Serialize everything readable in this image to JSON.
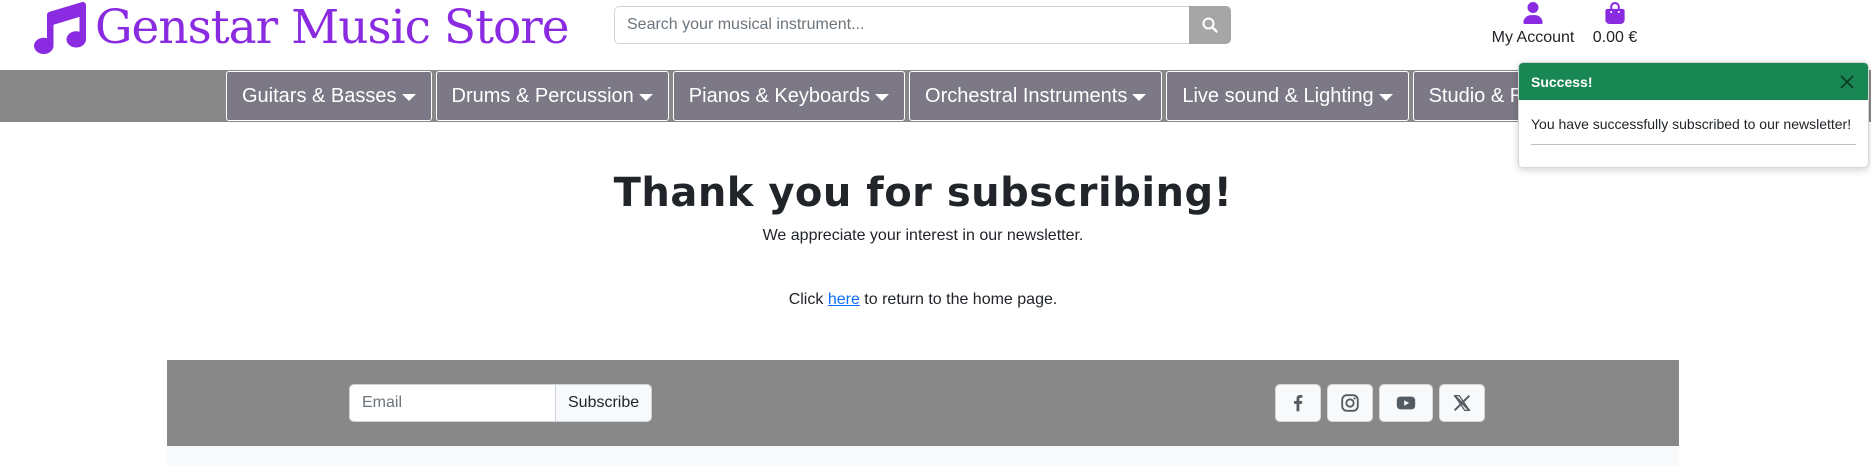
{
  "header": {
    "logo_text": "Genstar Music Store",
    "logo_icon": "music-note-icon",
    "search_placeholder": "Search your musical instrument...",
    "search_icon": "search-icon",
    "account_label": "My Account",
    "account_icon": "user-icon",
    "cart_total": "0.00 €",
    "cart_icon": "shopping-bag-icon"
  },
  "nav": {
    "items": [
      {
        "label": "Guitars & Basses"
      },
      {
        "label": "Drums & Percussion"
      },
      {
        "label": "Pianos & Keyboards"
      },
      {
        "label": "Orchestral Instruments"
      },
      {
        "label": "Live sound & Lighting"
      },
      {
        "label": "Studio & Re"
      }
    ]
  },
  "toast": {
    "title": "Success!",
    "message": "You have successfully subscribed to our newsletter!",
    "close_icon": "close-icon"
  },
  "main": {
    "heading": "Thank you for subscribing!",
    "subtext": "We appreciate your interest in our newsletter.",
    "return_prefix": "Click",
    "return_link": "here",
    "return_suffix": "to return to the home page."
  },
  "footer": {
    "email_placeholder": "Email",
    "subscribe_label": "Subscribe",
    "socials": [
      "facebook-icon",
      "instagram-icon",
      "youtube-icon",
      "x-icon"
    ]
  },
  "colors": {
    "brand": "#8a2be2",
    "nav_bg": "#888888",
    "nav_item_bg": "#7d7885",
    "success": "#198754",
    "link": "#0d6efd"
  }
}
